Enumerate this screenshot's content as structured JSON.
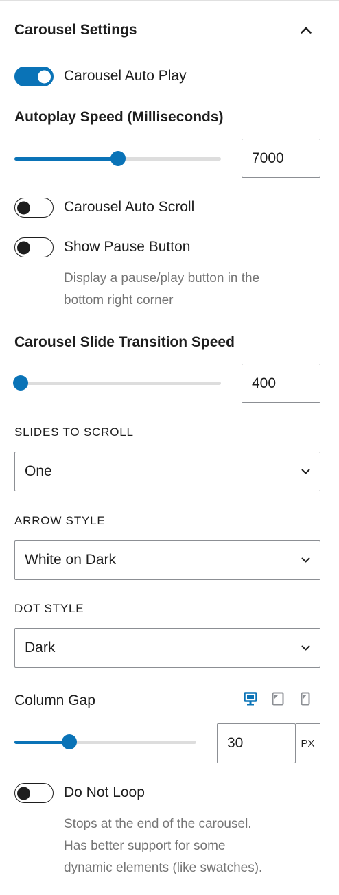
{
  "panel": {
    "title": "Carousel Settings"
  },
  "auto_play": {
    "label": "Carousel Auto Play",
    "enabled": true
  },
  "autoplay_speed": {
    "label": "Autoplay Speed (Milliseconds)",
    "value": "7000",
    "slider_fraction": 0.5
  },
  "auto_scroll": {
    "label": "Carousel Auto Scroll",
    "enabled": false
  },
  "pause_button": {
    "label": "Show Pause Button",
    "enabled": false,
    "help_line1": "Display a pause/play button in the",
    "help_line2": "bottom right corner"
  },
  "transition_speed": {
    "label": "Carousel Slide Transition Speed",
    "value": "400",
    "slider_fraction": 0.03
  },
  "slides_to_scroll": {
    "label": "SLIDES TO SCROLL",
    "value": "One"
  },
  "arrow_style": {
    "label": "ARROW STYLE",
    "value": "White on Dark"
  },
  "dot_style": {
    "label": "DOT STYLE",
    "value": "Dark"
  },
  "column_gap": {
    "label": "Column Gap",
    "value": "30",
    "unit": "PX",
    "slider_fraction": 0.3,
    "devices": [
      "desktop-icon",
      "tablet-icon",
      "mobile-icon"
    ],
    "active_device": "desktop"
  },
  "do_not_loop": {
    "label": "Do Not Loop",
    "enabled": false,
    "help_line1": "Stops at the end of the carousel.",
    "help_line2": "Has better support for some",
    "help_line3": "dynamic elements (like swatches)."
  },
  "colors": {
    "accent": "#0a73b7",
    "track": "#dddddd",
    "help_text": "#757575",
    "border": "#8c8f94"
  }
}
